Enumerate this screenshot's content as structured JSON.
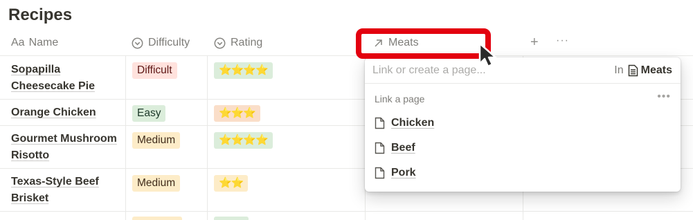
{
  "page": {
    "title": "Recipes"
  },
  "header": {
    "name_prefix": "Aa",
    "name_label": "Name",
    "difficulty_label": "Difficulty",
    "rating_label": "Rating",
    "meats_label": "Meats",
    "add_label": "+",
    "more_label": "···"
  },
  "rows": [
    {
      "name_line1": "Sopapilla",
      "name_line2": "Cheesecake Pie",
      "difficulty": "Difficult",
      "difficulty_color": "#ffe2dd",
      "rating": "⭐⭐⭐⭐"
    },
    {
      "name_line1": "Orange Chicken",
      "name_line2": "",
      "difficulty": "Easy",
      "difficulty_color": "#dbeddb",
      "rating": "⭐⭐⭐"
    },
    {
      "name_line1": "Gourmet Mushroom",
      "name_line2": "Risotto",
      "difficulty": "Medium",
      "difficulty_color": "#fdecc8",
      "rating": "⭐⭐⭐⭐"
    },
    {
      "name_line1": "Texas-Style Beef",
      "name_line2": "Brisket",
      "difficulty": "Medium",
      "difficulty_color": "#fdecc8",
      "rating": "⭐⭐"
    }
  ],
  "popup": {
    "search_placeholder": "Link or create a page...",
    "in_label": "In",
    "in_target": "Meats",
    "section_label": "Link a page",
    "more_label": "•••",
    "items": [
      {
        "label": "Chicken"
      },
      {
        "label": "Beef"
      },
      {
        "label": "Pork"
      }
    ]
  },
  "colors": {
    "highlight": "#e3000f",
    "text": "#37352f"
  },
  "icons": {
    "difficulty": "select-chevron-icon",
    "rating": "select-chevron-icon",
    "meats": "relation-arrow-icon",
    "page": "page-icon",
    "cursor": "mouse-pointer-icon"
  }
}
